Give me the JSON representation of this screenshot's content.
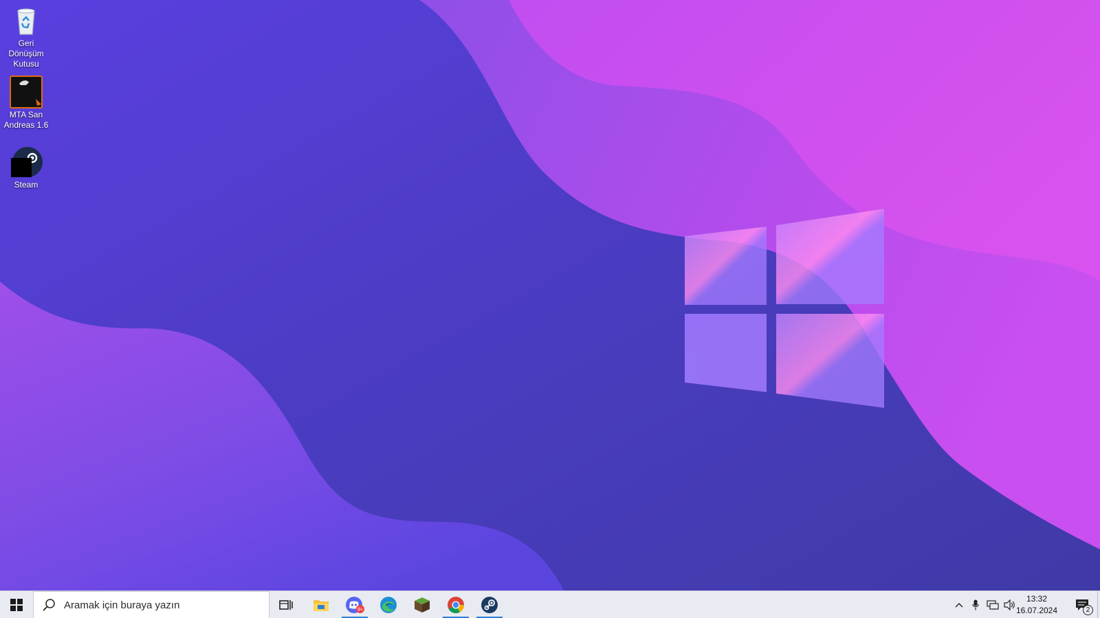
{
  "desktop": {
    "icons": [
      {
        "label": "Geri Dönüşüm Kutusu",
        "icon": "recycle-bin-icon"
      },
      {
        "label": "MTA San Andreas 1.6",
        "icon": "mta-icon"
      },
      {
        "label": "Steam",
        "icon": "steam-icon"
      }
    ],
    "wallpaper": {
      "style": "purple waves with windows logo",
      "colors": [
        "#5b3fdc",
        "#4a39b8",
        "#9b4ae6",
        "#d24fee"
      ]
    }
  },
  "taskbar": {
    "start_icon": "windows-start-icon",
    "search": {
      "placeholder": "Aramak için buraya yazın"
    },
    "pinned": [
      {
        "name": "task-view",
        "icon": "task-view-icon",
        "active": false
      },
      {
        "name": "file-explorer",
        "icon": "folder-icon",
        "active": false
      },
      {
        "name": "discord",
        "icon": "discord-icon",
        "active": true,
        "badge": "9+"
      },
      {
        "name": "edge",
        "icon": "edge-icon",
        "active": false
      },
      {
        "name": "minecraft",
        "icon": "minecraft-icon",
        "active": false
      },
      {
        "name": "chrome",
        "icon": "chrome-icon",
        "active": true
      },
      {
        "name": "steam",
        "icon": "steam-icon",
        "active": true
      }
    ],
    "tray": {
      "icons": [
        "chevron-up-icon",
        "microphone-icon",
        "network-icon",
        "volume-icon"
      ],
      "time": "13:32",
      "date": "16.07.2024",
      "notifications_count": "2"
    }
  }
}
